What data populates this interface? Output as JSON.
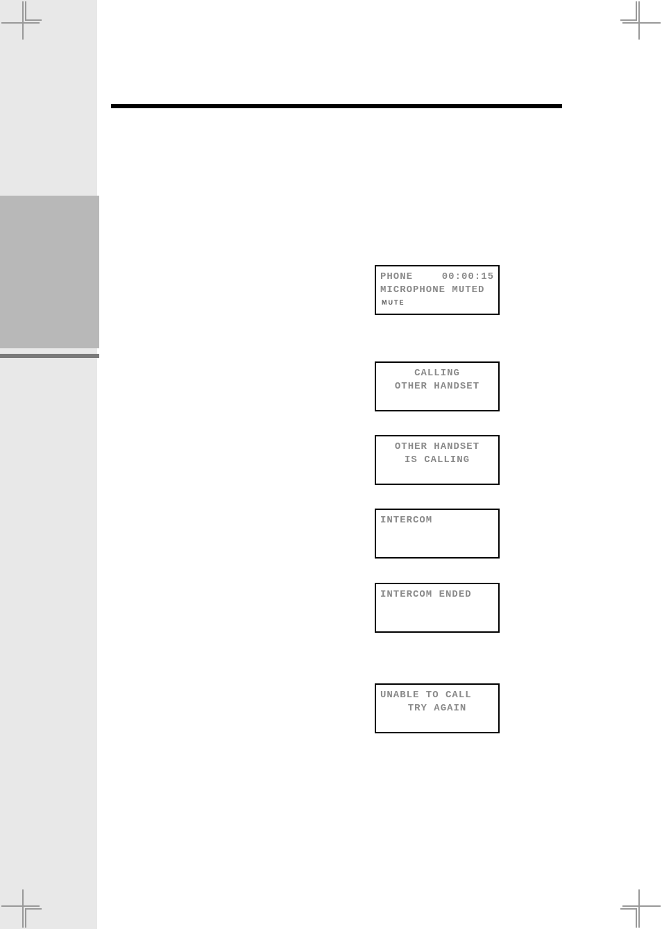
{
  "screens": {
    "mute": {
      "label": "PHONE",
      "timer": "00:00:15",
      "status": "MICROPHONE MUTED",
      "icon_label": "MUTE"
    },
    "calling": {
      "line1": "CALLING",
      "line2": "OTHER HANDSET"
    },
    "being_called": {
      "line1": "OTHER HANDSET",
      "line2": "IS CALLING"
    },
    "intercom": {
      "line1": "INTERCOM"
    },
    "intercom_ended": {
      "line1": "INTERCOM ENDED"
    },
    "unable": {
      "line1": "UNABLE TO CALL",
      "line2": "TRY AGAIN"
    }
  }
}
